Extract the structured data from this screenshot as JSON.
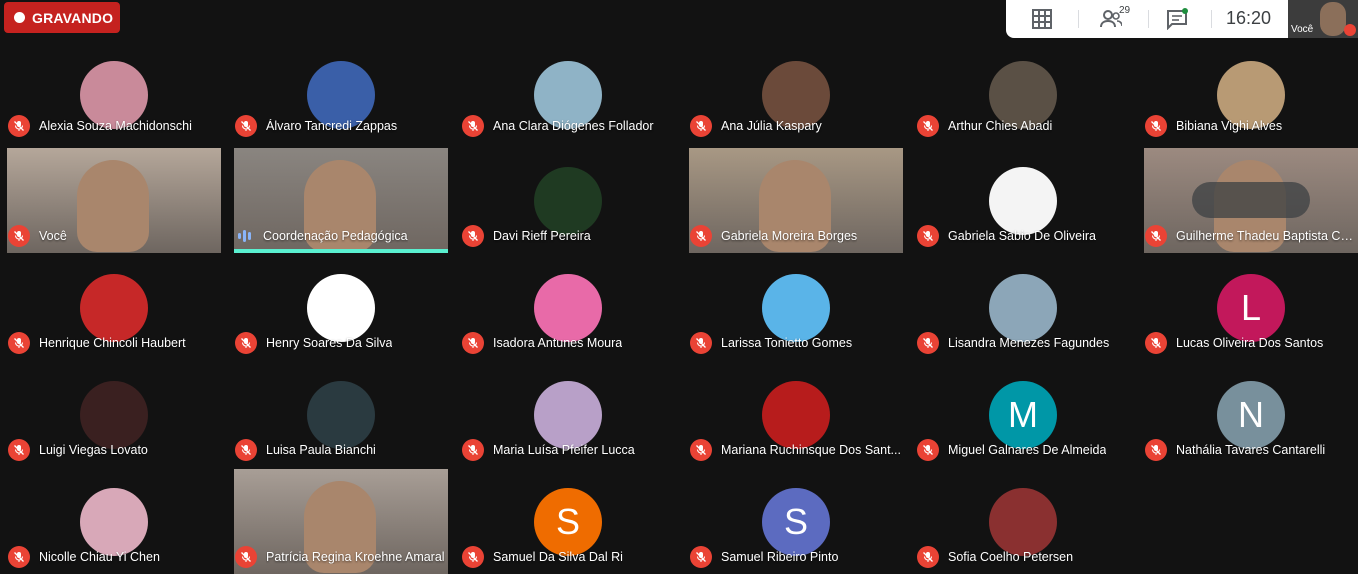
{
  "recording": {
    "label": "GRAVANDO"
  },
  "topbar": {
    "participant_count": "29",
    "time": "16:20",
    "self_label": "Você"
  },
  "participants": [
    {
      "name": "Alexia Souza Machidonschi",
      "kind": "avatar",
      "color": "#c98a9a"
    },
    {
      "name": "Álvaro Tancredi Zappas",
      "kind": "avatar",
      "color": "#3a5fa8"
    },
    {
      "name": "Ana Clara Diógenes Follador",
      "kind": "avatar",
      "color": "#8fb3c6"
    },
    {
      "name": "Ana Júlia Kaspary",
      "kind": "avatar",
      "color": "#6b4a3a"
    },
    {
      "name": "Arthur Chies Abadi",
      "kind": "avatar",
      "color": "#5a5045"
    },
    {
      "name": "Bibiana Vighi Alves",
      "kind": "avatar",
      "color": "#b89a74"
    },
    {
      "name": "Você",
      "kind": "video",
      "color": "#b5a79a"
    },
    {
      "name": "Coordenação Pedagógica",
      "kind": "video",
      "color": "#8a8580",
      "speaking": true
    },
    {
      "name": "Davi Rieff Pereira",
      "kind": "avatar",
      "color": "#1f3a22"
    },
    {
      "name": "Gabriela Moreira Borges",
      "kind": "video",
      "color": "#a89884"
    },
    {
      "name": "Gabriela Sabio De Oliveira",
      "kind": "avatar",
      "color": "#f4f4f4"
    },
    {
      "name": "Guilherme Thadeu Baptista Co...",
      "kind": "video",
      "color": "#9c8a80",
      "overlay": true
    },
    {
      "name": "Henrique Chincoli Haubert",
      "kind": "avatar",
      "color": "#c62828"
    },
    {
      "name": "Henry Soares Da Silva",
      "kind": "avatar",
      "color": "#ffffff"
    },
    {
      "name": "Isadora Antunes Moura",
      "kind": "avatar",
      "color": "#e86aa8"
    },
    {
      "name": "Larissa Tonietto Gomes",
      "kind": "avatar",
      "color": "#5ab4e8"
    },
    {
      "name": "Lisandra Menezes Fagundes",
      "kind": "avatar",
      "color": "#8ca6b8"
    },
    {
      "name": "Lucas Oliveira Dos Santos",
      "kind": "letter",
      "letter": "L",
      "color": "#c2185b"
    },
    {
      "name": "Luigi Viegas Lovato",
      "kind": "avatar",
      "color": "#3a2020"
    },
    {
      "name": "Luisa Paula Bianchi",
      "kind": "avatar",
      "color": "#2a3a40"
    },
    {
      "name": "Maria Luísa Pfeifer Lucca",
      "kind": "avatar",
      "color": "#b8a0c8"
    },
    {
      "name": "Mariana Ruchinsque Dos Sant...",
      "kind": "avatar",
      "color": "#b71c1c"
    },
    {
      "name": "Miguel Galnares De Almeida",
      "kind": "letter",
      "letter": "M",
      "color": "#0097a7"
    },
    {
      "name": "Nathália Tavares Cantarelli",
      "kind": "letter",
      "letter": "N",
      "color": "#78909c"
    },
    {
      "name": "Nicolle Chiau Yi Chen",
      "kind": "avatar",
      "color": "#d8a8b8"
    },
    {
      "name": "Patrícia Regina Kroehne Amaral",
      "kind": "video",
      "color": "#a89e96"
    },
    {
      "name": "Samuel Da Silva Dal Ri",
      "kind": "letter",
      "letter": "S",
      "color": "#ef6c00"
    },
    {
      "name": "Samuel Ribeiro Pinto",
      "kind": "letter",
      "letter": "S",
      "color": "#5c6bc0"
    },
    {
      "name": "Sofia Coelho Petersen",
      "kind": "avatar",
      "color": "#8a3030"
    }
  ]
}
